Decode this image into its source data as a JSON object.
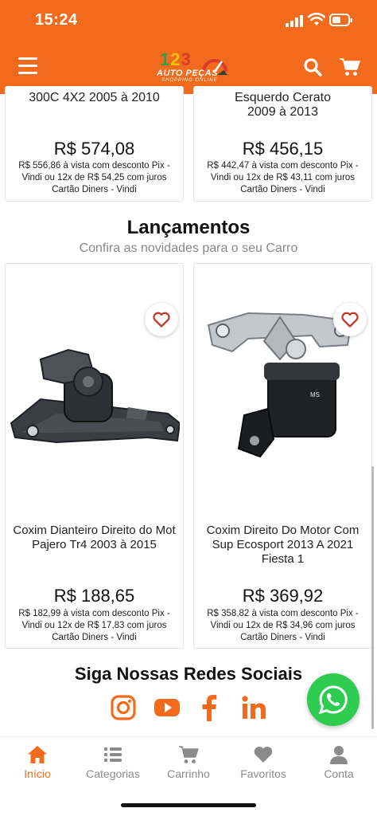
{
  "status": {
    "time": "15:24"
  },
  "header": {
    "logo_number": [
      "1",
      "2",
      "3"
    ],
    "logo_brand": "AUTO PEÇAS",
    "logo_tagline": "SHOPPING ONLINE"
  },
  "top_products": [
    {
      "title_tail": "300C 4X2 2005 à 2010",
      "price": "R$ 574,08",
      "terms": "R$ 556,86 à vista com desconto Pix - Vindi ou 12x de R$ 54,25 com juros Cartão Diners - Vindi"
    },
    {
      "title_tail": "Esquerdo Cerato 2009 à 2013",
      "price": "R$ 456,15",
      "terms": "R$ 442,47 à vista com desconto Pix - Vindi ou 12x de R$ 43,11 com juros Cartão Diners - Vindi"
    }
  ],
  "section": {
    "title": "Lançamentos",
    "subtitle": "Confira as novidades para o seu Carro"
  },
  "products": [
    {
      "title": "Coxim Dianteiro Direito do Mot Pajero Tr4 2003 à 2015",
      "price": "R$ 188,65",
      "terms": "R$ 182,99 à vista com desconto Pix - Vindi ou 12x de R$ 17,83 com juros Cartão Diners - Vindi"
    },
    {
      "title": "Coxim Direito Do Motor Com Sup Ecosport 2013 A 2021 Fiesta 1",
      "price": "R$ 369,92",
      "terms": "R$ 358,82 à vista com desconto Pix - Vindi ou 12x de R$ 34,96 com juros Cartão Diners - Vindi",
      "part_label": "MS"
    }
  ],
  "social": {
    "title": "Siga Nossas Redes Sociais",
    "icons": [
      "instagram-icon",
      "youtube-icon",
      "facebook-icon",
      "linkedin-icon"
    ]
  },
  "bottom_nav": [
    {
      "label": "Início",
      "icon": "home-icon",
      "active": true
    },
    {
      "label": "Categorias",
      "icon": "list-icon",
      "active": false
    },
    {
      "label": "Carrinho",
      "icon": "cart-icon",
      "active": false
    },
    {
      "label": "Favoritos",
      "icon": "heart-icon",
      "active": false
    },
    {
      "label": "Conta",
      "icon": "user-icon",
      "active": false
    }
  ],
  "colors": {
    "brand": "#f26a1b",
    "heart": "#c0392b",
    "whatsapp": "#2ecc51"
  }
}
